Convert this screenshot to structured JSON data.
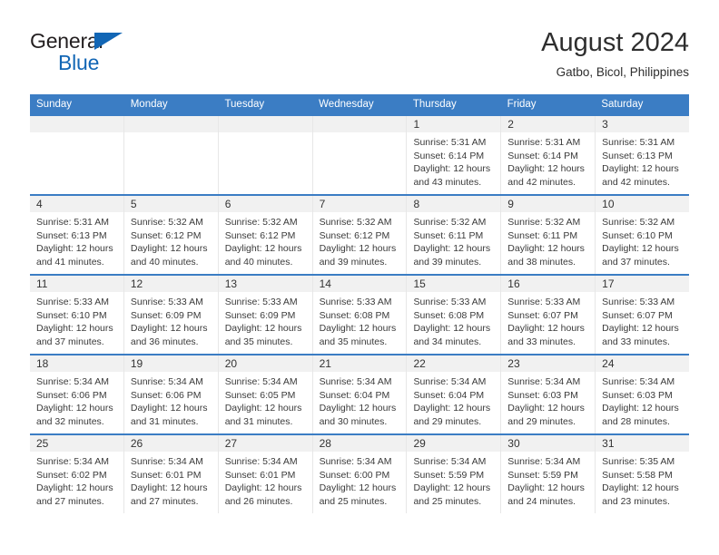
{
  "brand": {
    "name_top": "General",
    "name_bottom": "Blue",
    "accent_color": "#1266b5"
  },
  "header": {
    "title": "August 2024",
    "subtitle": "Gatbo, Bicol, Philippines"
  },
  "theme": {
    "header_row_color": "#3b7dc4",
    "daynum_band_color": "#f1f1f1",
    "text_color": "#3a3a3a"
  },
  "weekday_headers": [
    "Sunday",
    "Monday",
    "Tuesday",
    "Wednesday",
    "Thursday",
    "Friday",
    "Saturday"
  ],
  "labels": {
    "sunrise": "Sunrise:",
    "sunset": "Sunset:",
    "daylight": "Daylight:"
  },
  "weeks": [
    [
      {
        "day": "",
        "empty": true
      },
      {
        "day": "",
        "empty": true
      },
      {
        "day": "",
        "empty": true
      },
      {
        "day": "",
        "empty": true
      },
      {
        "day": "1",
        "sunrise": "Sunrise: 5:31 AM",
        "sunset": "Sunset: 6:14 PM",
        "daylight_1": "Daylight: 12 hours",
        "daylight_2": "and 43 minutes."
      },
      {
        "day": "2",
        "sunrise": "Sunrise: 5:31 AM",
        "sunset": "Sunset: 6:14 PM",
        "daylight_1": "Daylight: 12 hours",
        "daylight_2": "and 42 minutes."
      },
      {
        "day": "3",
        "sunrise": "Sunrise: 5:31 AM",
        "sunset": "Sunset: 6:13 PM",
        "daylight_1": "Daylight: 12 hours",
        "daylight_2": "and 42 minutes."
      }
    ],
    [
      {
        "day": "4",
        "sunrise": "Sunrise: 5:31 AM",
        "sunset": "Sunset: 6:13 PM",
        "daylight_1": "Daylight: 12 hours",
        "daylight_2": "and 41 minutes."
      },
      {
        "day": "5",
        "sunrise": "Sunrise: 5:32 AM",
        "sunset": "Sunset: 6:12 PM",
        "daylight_1": "Daylight: 12 hours",
        "daylight_2": "and 40 minutes."
      },
      {
        "day": "6",
        "sunrise": "Sunrise: 5:32 AM",
        "sunset": "Sunset: 6:12 PM",
        "daylight_1": "Daylight: 12 hours",
        "daylight_2": "and 40 minutes."
      },
      {
        "day": "7",
        "sunrise": "Sunrise: 5:32 AM",
        "sunset": "Sunset: 6:12 PM",
        "daylight_1": "Daylight: 12 hours",
        "daylight_2": "and 39 minutes."
      },
      {
        "day": "8",
        "sunrise": "Sunrise: 5:32 AM",
        "sunset": "Sunset: 6:11 PM",
        "daylight_1": "Daylight: 12 hours",
        "daylight_2": "and 39 minutes."
      },
      {
        "day": "9",
        "sunrise": "Sunrise: 5:32 AM",
        "sunset": "Sunset: 6:11 PM",
        "daylight_1": "Daylight: 12 hours",
        "daylight_2": "and 38 minutes."
      },
      {
        "day": "10",
        "sunrise": "Sunrise: 5:32 AM",
        "sunset": "Sunset: 6:10 PM",
        "daylight_1": "Daylight: 12 hours",
        "daylight_2": "and 37 minutes."
      }
    ],
    [
      {
        "day": "11",
        "sunrise": "Sunrise: 5:33 AM",
        "sunset": "Sunset: 6:10 PM",
        "daylight_1": "Daylight: 12 hours",
        "daylight_2": "and 37 minutes."
      },
      {
        "day": "12",
        "sunrise": "Sunrise: 5:33 AM",
        "sunset": "Sunset: 6:09 PM",
        "daylight_1": "Daylight: 12 hours",
        "daylight_2": "and 36 minutes."
      },
      {
        "day": "13",
        "sunrise": "Sunrise: 5:33 AM",
        "sunset": "Sunset: 6:09 PM",
        "daylight_1": "Daylight: 12 hours",
        "daylight_2": "and 35 minutes."
      },
      {
        "day": "14",
        "sunrise": "Sunrise: 5:33 AM",
        "sunset": "Sunset: 6:08 PM",
        "daylight_1": "Daylight: 12 hours",
        "daylight_2": "and 35 minutes."
      },
      {
        "day": "15",
        "sunrise": "Sunrise: 5:33 AM",
        "sunset": "Sunset: 6:08 PM",
        "daylight_1": "Daylight: 12 hours",
        "daylight_2": "and 34 minutes."
      },
      {
        "day": "16",
        "sunrise": "Sunrise: 5:33 AM",
        "sunset": "Sunset: 6:07 PM",
        "daylight_1": "Daylight: 12 hours",
        "daylight_2": "and 33 minutes."
      },
      {
        "day": "17",
        "sunrise": "Sunrise: 5:33 AM",
        "sunset": "Sunset: 6:07 PM",
        "daylight_1": "Daylight: 12 hours",
        "daylight_2": "and 33 minutes."
      }
    ],
    [
      {
        "day": "18",
        "sunrise": "Sunrise: 5:34 AM",
        "sunset": "Sunset: 6:06 PM",
        "daylight_1": "Daylight: 12 hours",
        "daylight_2": "and 32 minutes."
      },
      {
        "day": "19",
        "sunrise": "Sunrise: 5:34 AM",
        "sunset": "Sunset: 6:06 PM",
        "daylight_1": "Daylight: 12 hours",
        "daylight_2": "and 31 minutes."
      },
      {
        "day": "20",
        "sunrise": "Sunrise: 5:34 AM",
        "sunset": "Sunset: 6:05 PM",
        "daylight_1": "Daylight: 12 hours",
        "daylight_2": "and 31 minutes."
      },
      {
        "day": "21",
        "sunrise": "Sunrise: 5:34 AM",
        "sunset": "Sunset: 6:04 PM",
        "daylight_1": "Daylight: 12 hours",
        "daylight_2": "and 30 minutes."
      },
      {
        "day": "22",
        "sunrise": "Sunrise: 5:34 AM",
        "sunset": "Sunset: 6:04 PM",
        "daylight_1": "Daylight: 12 hours",
        "daylight_2": "and 29 minutes."
      },
      {
        "day": "23",
        "sunrise": "Sunrise: 5:34 AM",
        "sunset": "Sunset: 6:03 PM",
        "daylight_1": "Daylight: 12 hours",
        "daylight_2": "and 29 minutes."
      },
      {
        "day": "24",
        "sunrise": "Sunrise: 5:34 AM",
        "sunset": "Sunset: 6:03 PM",
        "daylight_1": "Daylight: 12 hours",
        "daylight_2": "and 28 minutes."
      }
    ],
    [
      {
        "day": "25",
        "sunrise": "Sunrise: 5:34 AM",
        "sunset": "Sunset: 6:02 PM",
        "daylight_1": "Daylight: 12 hours",
        "daylight_2": "and 27 minutes."
      },
      {
        "day": "26",
        "sunrise": "Sunrise: 5:34 AM",
        "sunset": "Sunset: 6:01 PM",
        "daylight_1": "Daylight: 12 hours",
        "daylight_2": "and 27 minutes."
      },
      {
        "day": "27",
        "sunrise": "Sunrise: 5:34 AM",
        "sunset": "Sunset: 6:01 PM",
        "daylight_1": "Daylight: 12 hours",
        "daylight_2": "and 26 minutes."
      },
      {
        "day": "28",
        "sunrise": "Sunrise: 5:34 AM",
        "sunset": "Sunset: 6:00 PM",
        "daylight_1": "Daylight: 12 hours",
        "daylight_2": "and 25 minutes."
      },
      {
        "day": "29",
        "sunrise": "Sunrise: 5:34 AM",
        "sunset": "Sunset: 5:59 PM",
        "daylight_1": "Daylight: 12 hours",
        "daylight_2": "and 25 minutes."
      },
      {
        "day": "30",
        "sunrise": "Sunrise: 5:34 AM",
        "sunset": "Sunset: 5:59 PM",
        "daylight_1": "Daylight: 12 hours",
        "daylight_2": "and 24 minutes."
      },
      {
        "day": "31",
        "sunrise": "Sunrise: 5:35 AM",
        "sunset": "Sunset: 5:58 PM",
        "daylight_1": "Daylight: 12 hours",
        "daylight_2": "and 23 minutes."
      }
    ]
  ]
}
